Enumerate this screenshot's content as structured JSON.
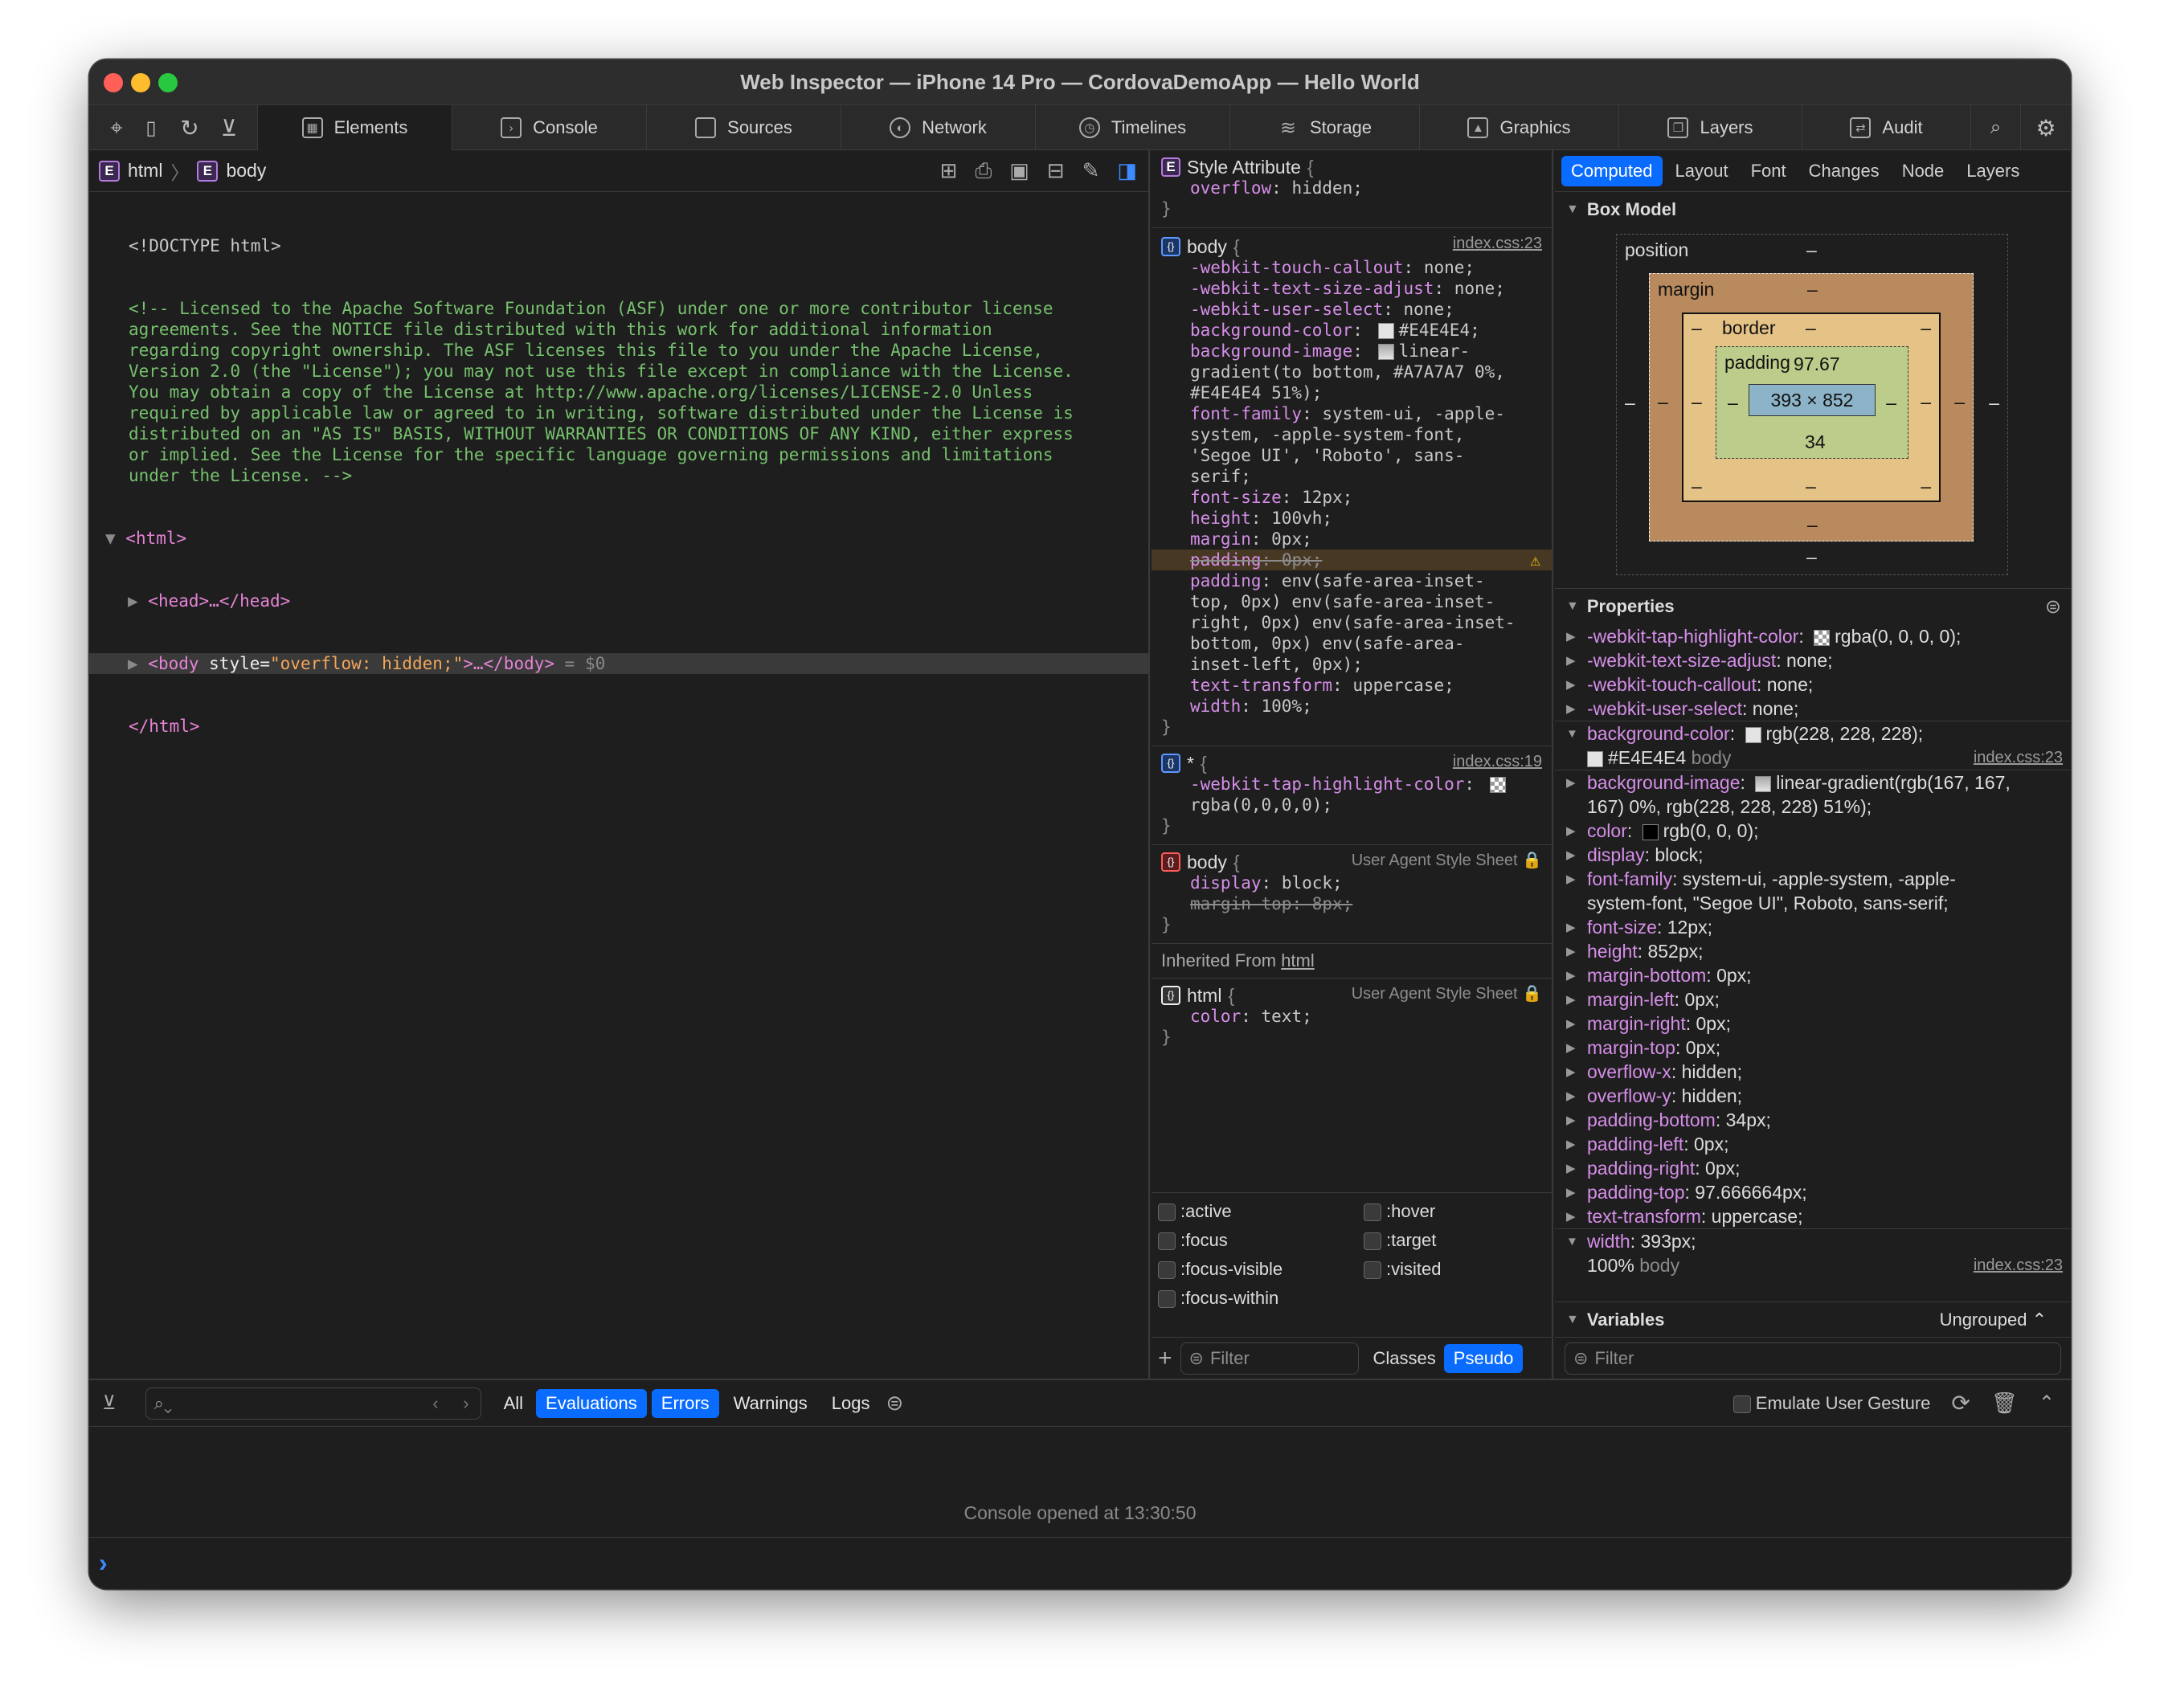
{
  "window": {
    "title": "Web Inspector — iPhone 14 Pro — CordovaDemoApp — Hello World"
  },
  "tabs": [
    {
      "label": "Elements",
      "icon": "elements-icon"
    },
    {
      "label": "Console",
      "icon": "console-icon"
    },
    {
      "label": "Sources",
      "icon": "sources-icon"
    },
    {
      "label": "Network",
      "icon": "network-icon"
    },
    {
      "label": "Timelines",
      "icon": "timelines-icon"
    },
    {
      "label": "Storage",
      "icon": "storage-icon"
    },
    {
      "label": "Graphics",
      "icon": "graphics-icon"
    },
    {
      "label": "Layers",
      "icon": "layers-icon"
    },
    {
      "label": "Audit",
      "icon": "audit-icon"
    }
  ],
  "breadcrumb": {
    "item1": "html",
    "item2": "body",
    "badge": "E"
  },
  "dom": {
    "doctype": "<!DOCTYPE html>",
    "comment": [
      "<!-- Licensed to the Apache Software Foundation (ASF) under one or more contributor license",
      "agreements. See the NOTICE file distributed with this work for additional information",
      "regarding copyright ownership. The ASF licenses this file to you under the Apache License,",
      "Version 2.0 (the \"License\"); you may not use this file except in compliance with the License.",
      "You may obtain a copy of the License at http://www.apache.org/licenses/LICENSE-2.0 Unless",
      "required by applicable law or agreed to in writing, software distributed under the License is",
      "distributed on an \"AS IS\" BASIS, WITHOUT WARRANTIES OR CONDITIONS OF ANY KIND, either express",
      "or implied. See the License for the specific language governing permissions and limitations",
      "under the License. -->"
    ],
    "html_open": "<html>",
    "head": "<head>…</head>",
    "body_open": "<body ",
    "body_attr": "style=",
    "body_val": "\"overflow: hidden;\"",
    "body_close": ">…</body>",
    "body_ref": " = $0",
    "html_close": "</html>"
  },
  "styles": {
    "style_attr": {
      "title": "Style Attribute",
      "brace": "{",
      "prop": "overflow",
      "value": "hidden;",
      "close": "}"
    },
    "rule1": {
      "selector": "body",
      "source": "index.css:23",
      "decls": [
        {
          "k": "-webkit-touch-callout",
          "v": "none;"
        },
        {
          "k": "-webkit-text-size-adjust",
          "v": "none;"
        },
        {
          "k": "-webkit-user-select",
          "v": "none;"
        },
        {
          "k": "background-color",
          "v": "#E4E4E4;"
        },
        {
          "k": "background-image",
          "v": "linear-"
        },
        {
          "k": "",
          "v": "gradient(to bottom, #A7A7A7 0%,"
        },
        {
          "k": "",
          "v": "#E4E4E4 51%);"
        },
        {
          "k": "font-family",
          "v": "system-ui, -apple-"
        },
        {
          "k": "",
          "v": "system, -apple-system-font,"
        },
        {
          "k": "",
          "v": "'Segoe UI', 'Roboto', sans-"
        },
        {
          "k": "",
          "v": "serif;"
        },
        {
          "k": "font-size",
          "v": "12px;"
        },
        {
          "k": "height",
          "v": "100vh;"
        },
        {
          "k": "margin",
          "v": "0px;"
        },
        {
          "k": "padding",
          "v": "0px;"
        },
        {
          "k": "padding",
          "v": "env(safe-area-inset-"
        },
        {
          "k": "",
          "v": "top, 0px) env(safe-area-inset-"
        },
        {
          "k": "",
          "v": "right, 0px) env(safe-area-inset-"
        },
        {
          "k": "",
          "v": "bottom, 0px) env(safe-area-"
        },
        {
          "k": "",
          "v": "inset-left, 0px);"
        },
        {
          "k": "text-transform",
          "v": "uppercase;"
        },
        {
          "k": "width",
          "v": "100%;"
        }
      ]
    },
    "rule2": {
      "selector": "*",
      "source": "index.css:19",
      "prop": "-webkit-tap-highlight-color",
      "value": "rgba(0,0,0,0);"
    },
    "rule3": {
      "selector": "body",
      "source": "User Agent Style Sheet",
      "prop1": "display",
      "val1": "block;",
      "prop2": "margin-top",
      "val2": "8px;"
    },
    "inherited": {
      "label": "Inherited From",
      "link": "html"
    },
    "rule4": {
      "selector": "html",
      "source": "User Agent Style Sheet",
      "prop": "color",
      "value": "text;"
    },
    "brace_open": "{",
    "brace_close": "}",
    "pseudo": [
      ":active",
      ":hover",
      ":focus",
      ":target",
      ":focus-visible",
      ":visited",
      ":focus-within"
    ],
    "filter_placeholder": "Filter",
    "classes": "Classes",
    "pseudo_btn": "Pseudo"
  },
  "computed": {
    "tabs": [
      "Computed",
      "Layout",
      "Font",
      "Changes",
      "Node",
      "Layers"
    ],
    "box_model_title": "Box Model",
    "box": {
      "position": "position",
      "margin": "margin",
      "border": "border",
      "padding": "padding",
      "size": "393 × 852",
      "pad_top": "97.67",
      "pad_bottom": "34",
      "dash": "–"
    },
    "properties_title": "Properties",
    "props": [
      {
        "n": "-webkit-tap-highlight-color",
        "v": "rgba(0, 0, 0, 0);"
      },
      {
        "n": "-webkit-text-size-adjust",
        "v": "none;"
      },
      {
        "n": "-webkit-touch-callout",
        "v": "none;"
      },
      {
        "n": "-webkit-user-select",
        "v": "none;"
      }
    ],
    "bg_color": {
      "n": "background-color",
      "v": "rgb(228, 228, 228);",
      "sub": "#E4E4E4",
      "subsel": "body",
      "src": "index.css:23"
    },
    "bg_image": {
      "n": "background-image",
      "v": "linear-gradient(rgb(167, 167,",
      "v2": "167) 0%, rgb(228, 228, 228) 51%);"
    },
    "props2": [
      {
        "n": "color",
        "v": "rgb(0, 0, 0);"
      },
      {
        "n": "display",
        "v": "block;"
      }
    ],
    "font_family": {
      "n": "font-family",
      "v": "system-ui, -apple-system, -apple-",
      "v2": "system-font, \"Segoe UI\", Roboto, sans-serif;"
    },
    "props3": [
      {
        "n": "font-size",
        "v": "12px;"
      },
      {
        "n": "height",
        "v": "852px;"
      },
      {
        "n": "margin-bottom",
        "v": "0px;"
      },
      {
        "n": "margin-left",
        "v": "0px;"
      },
      {
        "n": "margin-right",
        "v": "0px;"
      },
      {
        "n": "margin-top",
        "v": "0px;"
      },
      {
        "n": "overflow-x",
        "v": "hidden;"
      },
      {
        "n": "overflow-y",
        "v": "hidden;"
      },
      {
        "n": "padding-bottom",
        "v": "34px;"
      },
      {
        "n": "padding-left",
        "v": "0px;"
      },
      {
        "n": "padding-right",
        "v": "0px;"
      },
      {
        "n": "padding-top",
        "v": "97.666664px;"
      },
      {
        "n": "text-transform",
        "v": "uppercase;"
      }
    ],
    "width": {
      "n": "width",
      "v": "393px;",
      "sub": "100%",
      "subsel": "body",
      "src": "index.css:23"
    },
    "variables_title": "Variables",
    "ungrouped": "Ungrouped",
    "filter_placeholder": "Filter"
  },
  "console": {
    "filters": [
      "All",
      "Evaluations",
      "Errors",
      "Warnings",
      "Logs"
    ],
    "emulate": "Emulate User Gesture",
    "message": "Console opened at 13:30:50",
    "prompt": "›"
  },
  "colors": {
    "accent": "#0a6cff",
    "selector_purple": "#d58ee8",
    "comment_green": "#76c16d",
    "attr_orange": "#f2a65a",
    "swatch_gray": "#E4E4E4"
  }
}
